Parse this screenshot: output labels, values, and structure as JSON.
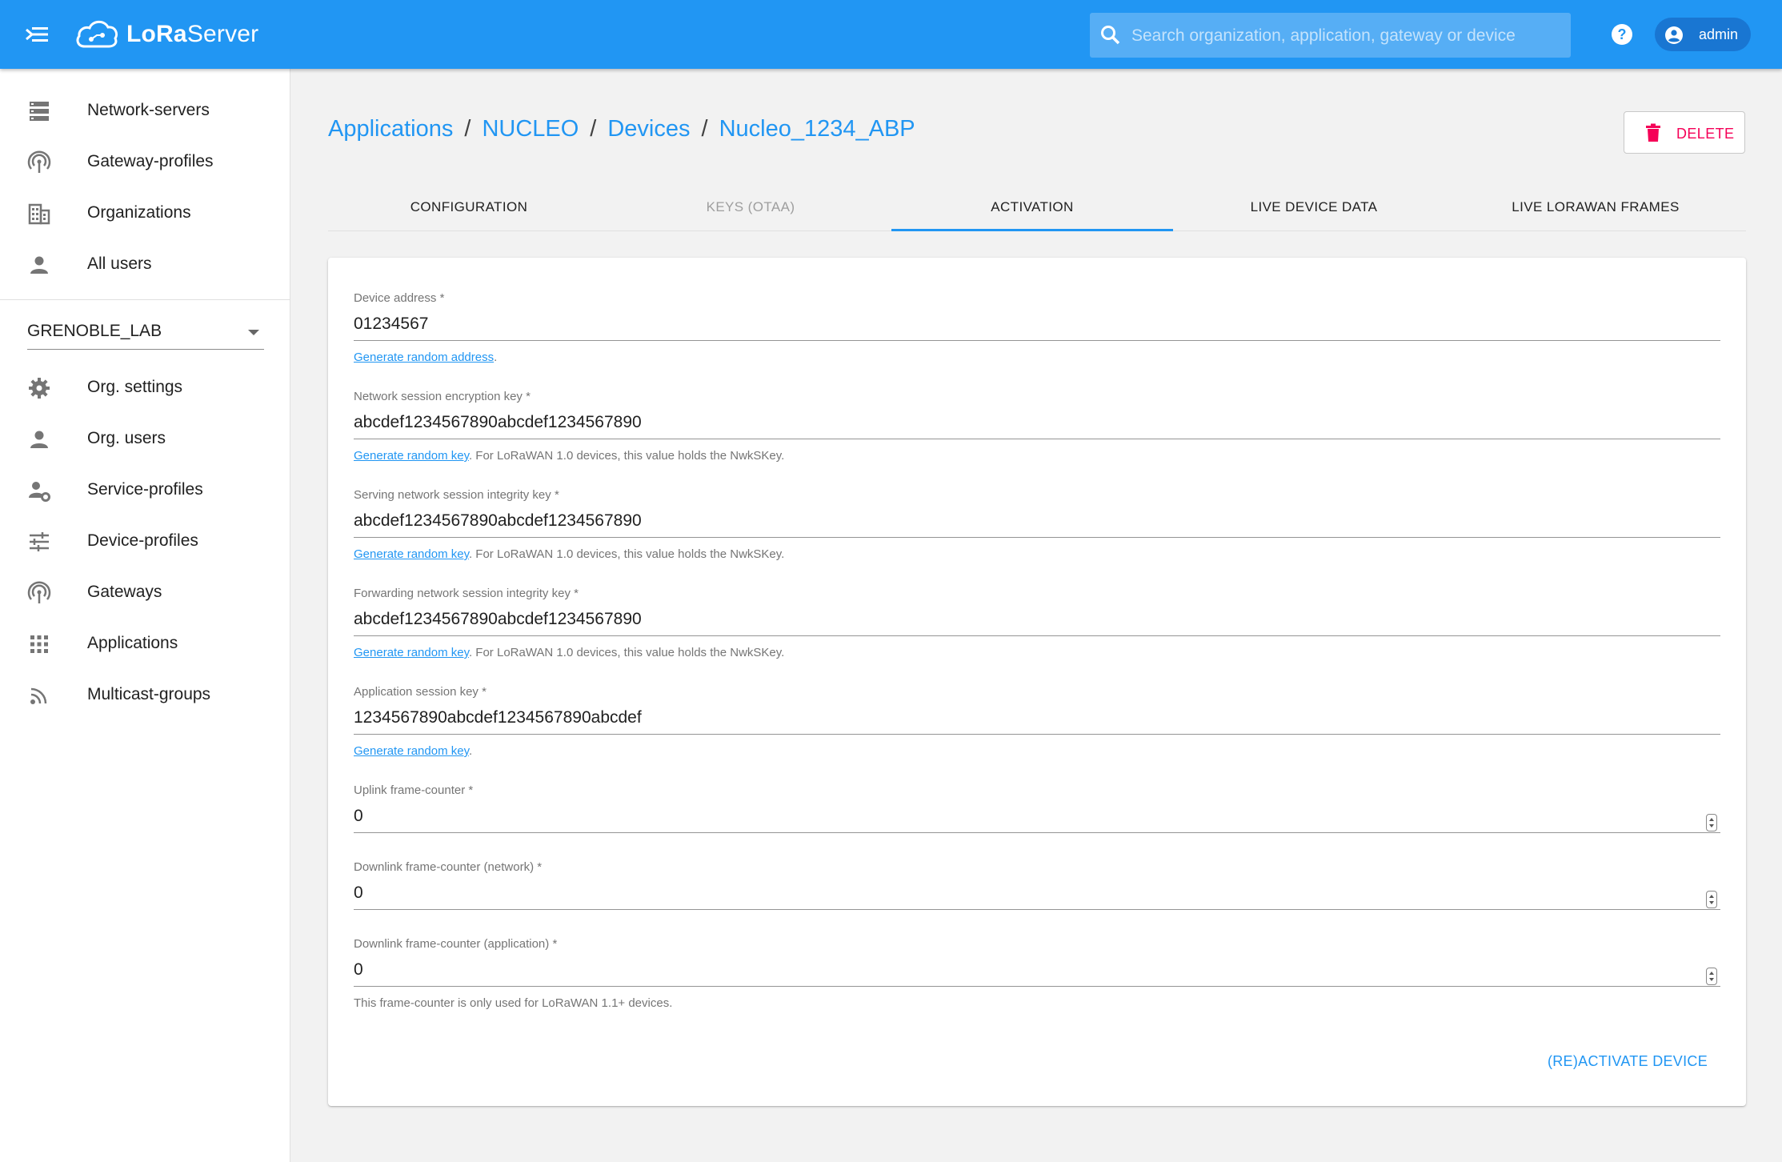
{
  "app": {
    "logo_text_bold": "LoRa",
    "logo_text_rest": "Server",
    "search_placeholder": "Search organization, application, gateway or device",
    "user": "admin",
    "accent_color": "#2196f3"
  },
  "sidebar": {
    "top_items": [
      {
        "label": "Network-servers",
        "icon": "server-icon"
      },
      {
        "label": "Gateway-profiles",
        "icon": "antenna-icon"
      },
      {
        "label": "Organizations",
        "icon": "building-icon"
      },
      {
        "label": "All users",
        "icon": "person-icon"
      }
    ],
    "org_selected": "GRENOBLE_LAB",
    "org_items": [
      {
        "label": "Org. settings",
        "icon": "gear-icon"
      },
      {
        "label": "Org. users",
        "icon": "person-icon"
      },
      {
        "label": "Service-profiles",
        "icon": "person-gear-icon"
      },
      {
        "label": "Device-profiles",
        "icon": "tune-icon"
      },
      {
        "label": "Gateways",
        "icon": "antenna-icon"
      },
      {
        "label": "Applications",
        "icon": "apps-grid-icon"
      },
      {
        "label": "Multicast-groups",
        "icon": "rss-icon"
      }
    ]
  },
  "breadcrumb": [
    "Applications",
    "NUCLEO",
    "Devices",
    "Nucleo_1234_ABP"
  ],
  "delete_label": "DELETE",
  "tabs": [
    "CONFIGURATION",
    "KEYS (OTAA)",
    "ACTIVATION",
    "LIVE DEVICE DATA",
    "LIVE LORAWAN FRAMES"
  ],
  "active_tab": "ACTIVATION",
  "form": {
    "fields": [
      {
        "label": "Device address",
        "value": "01234567",
        "link": "Generate random address",
        "helper": "."
      },
      {
        "label": "Network session encryption key",
        "value": "abcdef1234567890abcdef1234567890",
        "link": "Generate random key",
        "helper": ". For LoRaWAN 1.0 devices, this value holds the NwkSKey."
      },
      {
        "label": "Serving network session integrity key",
        "value": "abcdef1234567890abcdef1234567890",
        "link": "Generate random key",
        "helper": ". For LoRaWAN 1.0 devices, this value holds the NwkSKey."
      },
      {
        "label": "Forwarding network session integrity key",
        "value": "abcdef1234567890abcdef1234567890",
        "link": "Generate random key",
        "helper": ". For LoRaWAN 1.0 devices, this value holds the NwkSKey."
      },
      {
        "label": "Application session key",
        "value": "1234567890abcdef1234567890abcdef",
        "link": "Generate random key",
        "helper": "."
      },
      {
        "label": "Uplink frame-counter",
        "value": "0"
      },
      {
        "label": "Downlink frame-counter (network)",
        "value": "0"
      },
      {
        "label": "Downlink frame-counter (application)",
        "value": "0",
        "helper": "This frame-counter is only used for LoRaWAN 1.1+ devices."
      }
    ],
    "required_mark": "*",
    "submit_label": "(RE)ACTIVATE DEVICE"
  }
}
